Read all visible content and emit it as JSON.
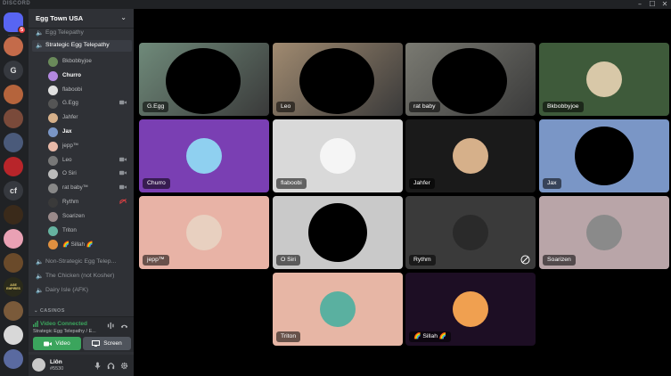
{
  "titlebar": {
    "brand": "DISCORD",
    "minimize": "–",
    "maximize": "☐",
    "close": "✕"
  },
  "server_rail": {
    "home_badge": "5",
    "servers": [
      {
        "label": "",
        "color": "#5865f2"
      },
      {
        "label": "",
        "color": "#c46b4a"
      },
      {
        "label": "G",
        "color": "#36393f"
      },
      {
        "label": "",
        "color": "#b5643c"
      },
      {
        "label": "",
        "color": "#7a4a3a"
      },
      {
        "label": "",
        "color": "#4a5a7a"
      },
      {
        "label": "",
        "color": "#b8252a"
      },
      {
        "label": "cf",
        "color": "#36393f"
      },
      {
        "label": "",
        "color": "#3a2a1a"
      },
      {
        "label": "",
        "color": "#e9a1b4"
      },
      {
        "label": "",
        "color": "#6a4a2a"
      },
      {
        "label": "AGE EMPIRES",
        "color": "#2a2a1a"
      },
      {
        "label": "",
        "color": "#7a5a3a"
      },
      {
        "label": "",
        "color": "#d8d8d8"
      },
      {
        "label": "",
        "color": "#5a6aa0"
      }
    ]
  },
  "sidebar": {
    "guild_name": "Egg Town USA",
    "channels_top": [
      {
        "name": "Egg Telepathy",
        "active": false
      },
      {
        "name": "Strategic Egg Telepathy",
        "active": true
      }
    ],
    "voice_users": [
      {
        "name": "Bkbobbyjoe",
        "color": "#6a8a5a",
        "speaking": false,
        "icon": ""
      },
      {
        "name": "Churro",
        "color": "#b388e0",
        "speaking": true,
        "icon": ""
      },
      {
        "name": "flaboobi",
        "color": "#e0e0e0",
        "speaking": false,
        "icon": ""
      },
      {
        "name": "G.Egg",
        "color": "#555555",
        "speaking": false,
        "icon": "video-icon"
      },
      {
        "name": "Jahfer",
        "color": "#d6b08a",
        "speaking": false,
        "icon": ""
      },
      {
        "name": "Jax",
        "color": "#7a96c6",
        "speaking": true,
        "icon": ""
      },
      {
        "name": "jepp™",
        "color": "#e8b9a8",
        "speaking": false,
        "icon": ""
      },
      {
        "name": "Leo",
        "color": "#777777",
        "speaking": false,
        "icon": "video-icon"
      },
      {
        "name": "O Siri",
        "color": "#bbbbbb",
        "speaking": false,
        "icon": "video-icon"
      },
      {
        "name": "rat baby™",
        "color": "#888888",
        "speaking": false,
        "icon": "video-icon"
      },
      {
        "name": "Rythm",
        "color": "#3a3a3a",
        "speaking": false,
        "icon": "deafen-icon"
      },
      {
        "name": "Soarizen",
        "color": "#9a8a8a",
        "speaking": false,
        "icon": ""
      },
      {
        "name": "Triton",
        "color": "#66b3a0",
        "speaking": false,
        "icon": ""
      },
      {
        "name": "🌈 Sillah 🌈",
        "color": "#e09040",
        "speaking": false,
        "icon": ""
      }
    ],
    "channels_bottom": [
      {
        "name": "Non-Strategic Egg Telep..."
      },
      {
        "name": "The Chicken (not Kosher)"
      },
      {
        "name": "Dairy Isle (AFK)"
      }
    ],
    "category": "CASINOS"
  },
  "voice_panel": {
    "status": "Video Connected",
    "channel": "Strategic Egg Telepathy / E...",
    "video_label": "Video",
    "screen_label": "Screen"
  },
  "user_panel": {
    "name": "Liôn",
    "tag": "#5530"
  },
  "tiles": [
    {
      "label": "G.Egg",
      "bg": "#6f8a7a",
      "kind": "camera",
      "muted": false
    },
    {
      "label": "Leo",
      "bg": "#a08a70",
      "kind": "camera",
      "muted": false
    },
    {
      "label": "rat baby",
      "bg": "#7a7a72",
      "kind": "camera",
      "muted": false
    },
    {
      "label": "Bkbobbyjoe",
      "bg": "#3e5a3a",
      "kind": "avatar",
      "avatar_color": "#d8c8a8",
      "muted": false
    },
    {
      "label": "Churro",
      "bg": "#7a3fb3",
      "kind": "avatar",
      "avatar_color": "#8fd0f0",
      "muted": false
    },
    {
      "label": "flaboobi",
      "bg": "#d9d9d9",
      "kind": "avatar",
      "avatar_color": "#f5f5f5",
      "muted": false
    },
    {
      "label": "Jahfer",
      "bg": "#1a1a1a",
      "kind": "avatar",
      "avatar_color": "#d6b08a",
      "muted": false
    },
    {
      "label": "Jax",
      "bg": "#7a96c6",
      "kind": "avatar",
      "avatar_color": "#000000",
      "muted": false
    },
    {
      "label": "jepp™",
      "bg": "#e8b3a6",
      "kind": "avatar",
      "avatar_color": "#e8d0c0",
      "muted": false
    },
    {
      "label": "O Siri",
      "bg": "#c9c9c9",
      "kind": "avatar",
      "avatar_color": "#000000",
      "muted": false
    },
    {
      "label": "Rythm",
      "bg": "#3a3a3a",
      "kind": "avatar",
      "avatar_color": "#2a2a2a",
      "muted": true
    },
    {
      "label": "Soarizen",
      "bg": "#b9a5a8",
      "kind": "avatar",
      "avatar_color": "#8a8a8a",
      "muted": false
    },
    {
      "label": "Triton",
      "bg": "#e7b6a5",
      "kind": "avatar",
      "avatar_color": "#5ab0a0",
      "muted": false
    },
    {
      "label": "🌈 Sillah 🌈",
      "bg": "#1d0e24",
      "kind": "avatar",
      "avatar_color": "#f0a050",
      "muted": false
    }
  ]
}
